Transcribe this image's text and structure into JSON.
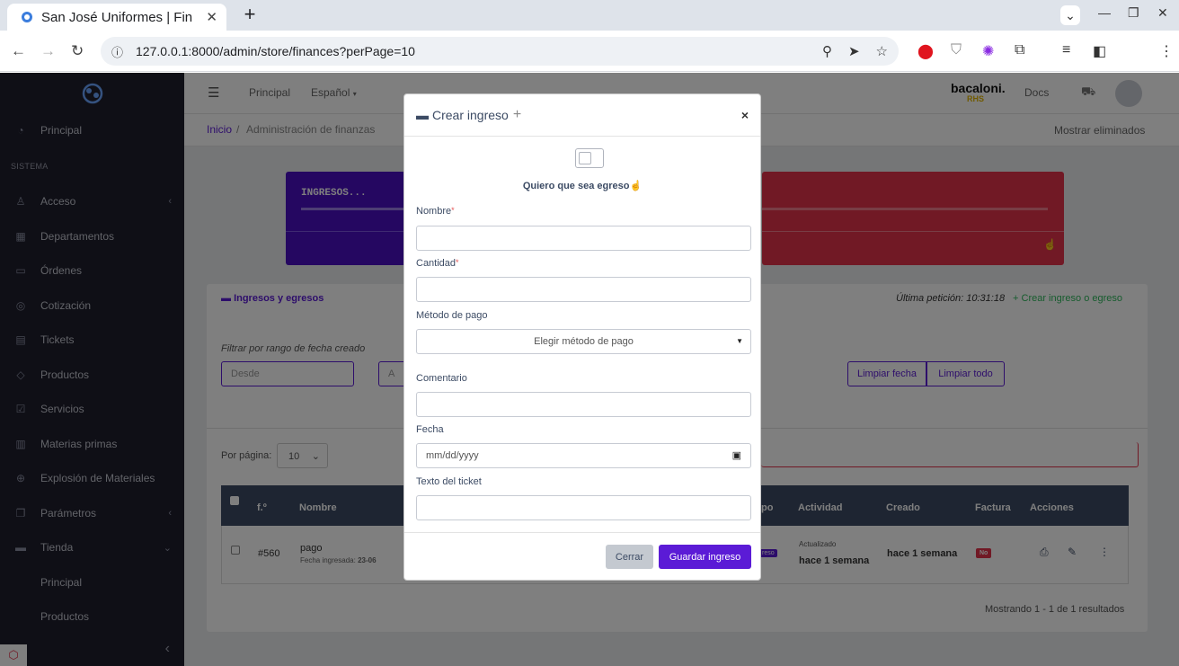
{
  "browser": {
    "tab_title": "San José Uniformes | Fin",
    "url": "127.0.0.1:8000/admin/store/finances?perPage=10"
  },
  "sidebar": {
    "section_label": "SISTEMA",
    "items": [
      {
        "label": "Principal",
        "icon": "gauge-icon"
      },
      {
        "label": "Acceso",
        "icon": "user-icon"
      },
      {
        "label": "Departamentos",
        "icon": "grid-icon"
      },
      {
        "label": "Órdenes",
        "icon": "orders-icon"
      },
      {
        "label": "Cotización",
        "icon": "quote-icon"
      },
      {
        "label": "Tickets",
        "icon": "ticket-icon"
      },
      {
        "label": "Productos",
        "icon": "tag-icon"
      },
      {
        "label": "Servicios",
        "icon": "check-icon"
      },
      {
        "label": "Materias primas",
        "icon": "boxes-icon"
      },
      {
        "label": "Explosión de Materiales",
        "icon": "globe-icon"
      },
      {
        "label": "Parámetros",
        "icon": "layers-icon"
      },
      {
        "label": "Tienda",
        "icon": "store-icon"
      }
    ],
    "sub_items": [
      "Principal",
      "Productos"
    ]
  },
  "topnav": {
    "link_principal": "Principal",
    "link_lang": "Español",
    "brand": "bacaloni.",
    "brand_sub": "RHS",
    "docs": "Docs"
  },
  "breadcrumb": {
    "home": "Inicio",
    "separator": "/",
    "current": "Administración de finanzas",
    "show_deleted": "Mostrar eliminados"
  },
  "stats": {
    "ingresos_label": "INGRESOS..."
  },
  "panel": {
    "title": "Ingresos y egresos",
    "last_request": "Última petición: 10:31:18",
    "create_link": "Crear ingreso o egreso",
    "filter_label": "Filtrar por rango de fecha creado",
    "from_placeholder": "Desde",
    "to_placeholder": "A",
    "clear_date": "Limpiar fecha",
    "clear_all": "Limpiar todo",
    "per_page_label": "Por página:",
    "per_page_value": "10",
    "showing": "Mostrando 1 - 1 de 1 resultados"
  },
  "table": {
    "headers": [
      "f.º",
      "Nombre",
      "po",
      "Actividad",
      "Creado",
      "Factura",
      "Acciones"
    ],
    "row": {
      "folio": "#560",
      "name": "pago",
      "sub": "Fecha ingresada:",
      "sub_date": "23-06",
      "type_badge": "reso",
      "activity_top": "Actualizado",
      "activity": "hace 1 semana",
      "created": "hace 1 semana",
      "invoice": "No"
    }
  },
  "modal": {
    "title": "Crear ingreso",
    "toggle_label": "Quiero que sea egreso",
    "fields": {
      "nombre": "Nombre",
      "cantidad": "Cantidad",
      "metodo": "Método de pago",
      "metodo_placeholder": "Elegir método de pago",
      "comentario": "Comentario",
      "fecha": "Fecha",
      "fecha_placeholder": "mm/dd/yyyy",
      "ticket": "Texto del ticket"
    },
    "required_mark": "*",
    "close_btn": "Cerrar",
    "save_btn": "Guardar ingreso"
  },
  "colors": {
    "primary": "#5b1bd6",
    "sidebar": "#1e1e2d",
    "danger": "#e3324a",
    "success": "#2eb85c"
  }
}
